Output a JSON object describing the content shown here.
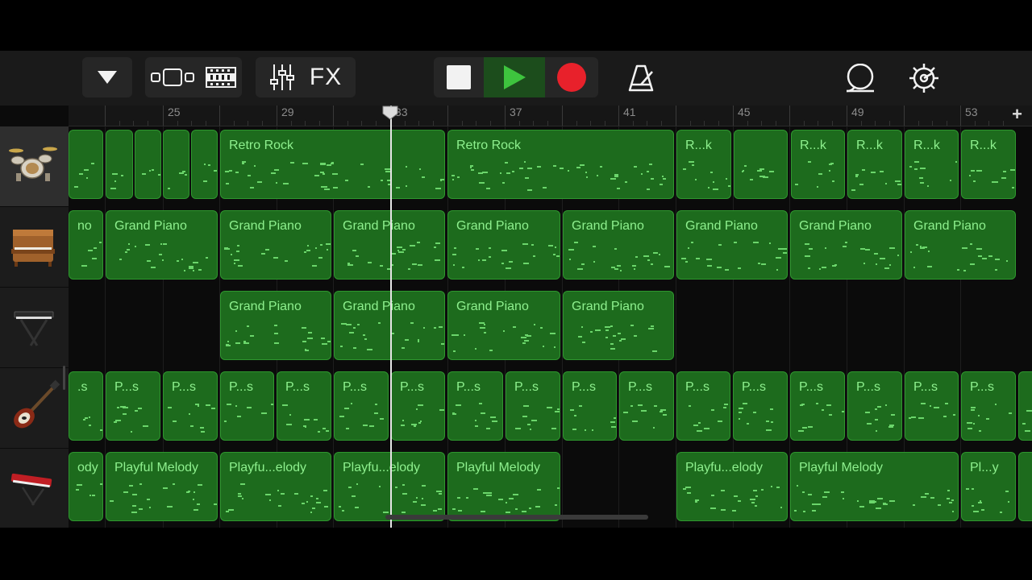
{
  "toolbar": {
    "fx_label": "FX",
    "icons": [
      "dropdown-triangle-icon",
      "browser-view-icon",
      "tracks-view-icon",
      "mixer-icon",
      "fx",
      "stop-icon",
      "play-icon",
      "record-icon",
      "metronome-icon",
      "loop-icon",
      "settings-icon"
    ]
  },
  "ruler": {
    "labels": [
      "25",
      "29",
      "33",
      "37",
      "41",
      "45",
      "49",
      "53"
    ],
    "add_label": "+"
  },
  "tracks": [
    {
      "instrument": "drums-icon",
      "regions": [
        {
          "name": ""
        },
        {
          "name": ""
        },
        {
          "name": ""
        },
        {
          "name": ""
        },
        {
          "name": ""
        },
        {
          "name": "Retro Rock"
        },
        {
          "name": "Retro Rock"
        },
        {
          "name": "R...k"
        },
        {
          "name": ""
        },
        {
          "name": "R...k"
        },
        {
          "name": "R...k"
        },
        {
          "name": "R...k"
        },
        {
          "name": "R...k"
        }
      ]
    },
    {
      "instrument": "upright-piano-icon",
      "regions": [
        {
          "name": "no"
        },
        {
          "name": "Grand Piano"
        },
        {
          "name": "Grand Piano"
        },
        {
          "name": "Grand Piano"
        },
        {
          "name": "Grand Piano"
        },
        {
          "name": "Grand Piano"
        },
        {
          "name": "Grand Piano"
        },
        {
          "name": "Grand Piano"
        },
        {
          "name": "Grand Piano"
        }
      ]
    },
    {
      "instrument": "keyboard-stand-icon",
      "regions": [
        {
          "name": "Grand Piano"
        },
        {
          "name": "Grand Piano"
        },
        {
          "name": "Grand Piano"
        },
        {
          "name": "Grand Piano"
        }
      ]
    },
    {
      "instrument": "electric-bass-icon",
      "regions": [
        {
          "name": ".s"
        },
        {
          "name": "P...s"
        },
        {
          "name": "P...s"
        },
        {
          "name": "P...s"
        },
        {
          "name": "P...s"
        },
        {
          "name": "P...s"
        },
        {
          "name": "P...s"
        },
        {
          "name": "P...s"
        },
        {
          "name": "P...s"
        },
        {
          "name": "P...s"
        },
        {
          "name": "P...s"
        },
        {
          "name": "P...s"
        },
        {
          "name": "P...s"
        },
        {
          "name": "P...s"
        },
        {
          "name": "P...s"
        },
        {
          "name": "P...s"
        },
        {
          "name": "P...s"
        },
        {
          "name": ""
        }
      ]
    },
    {
      "instrument": "red-synth-icon",
      "regions": [
        {
          "name": "ody"
        },
        {
          "name": "Playful Melody"
        },
        {
          "name": "Playfu...elody"
        },
        {
          "name": "Playfu...elody"
        },
        {
          "name": "Playful Melody"
        },
        {
          "name": "Playfu...elody"
        },
        {
          "name": "Playful Melody"
        },
        {
          "name": "Pl...y"
        },
        {
          "name": ""
        }
      ]
    }
  ],
  "colors": {
    "region_fill": "#1d6b1d",
    "region_border": "#2e962e",
    "region_text": "#8ef08e",
    "record": "#e8212b",
    "play": "#3ec43e"
  }
}
